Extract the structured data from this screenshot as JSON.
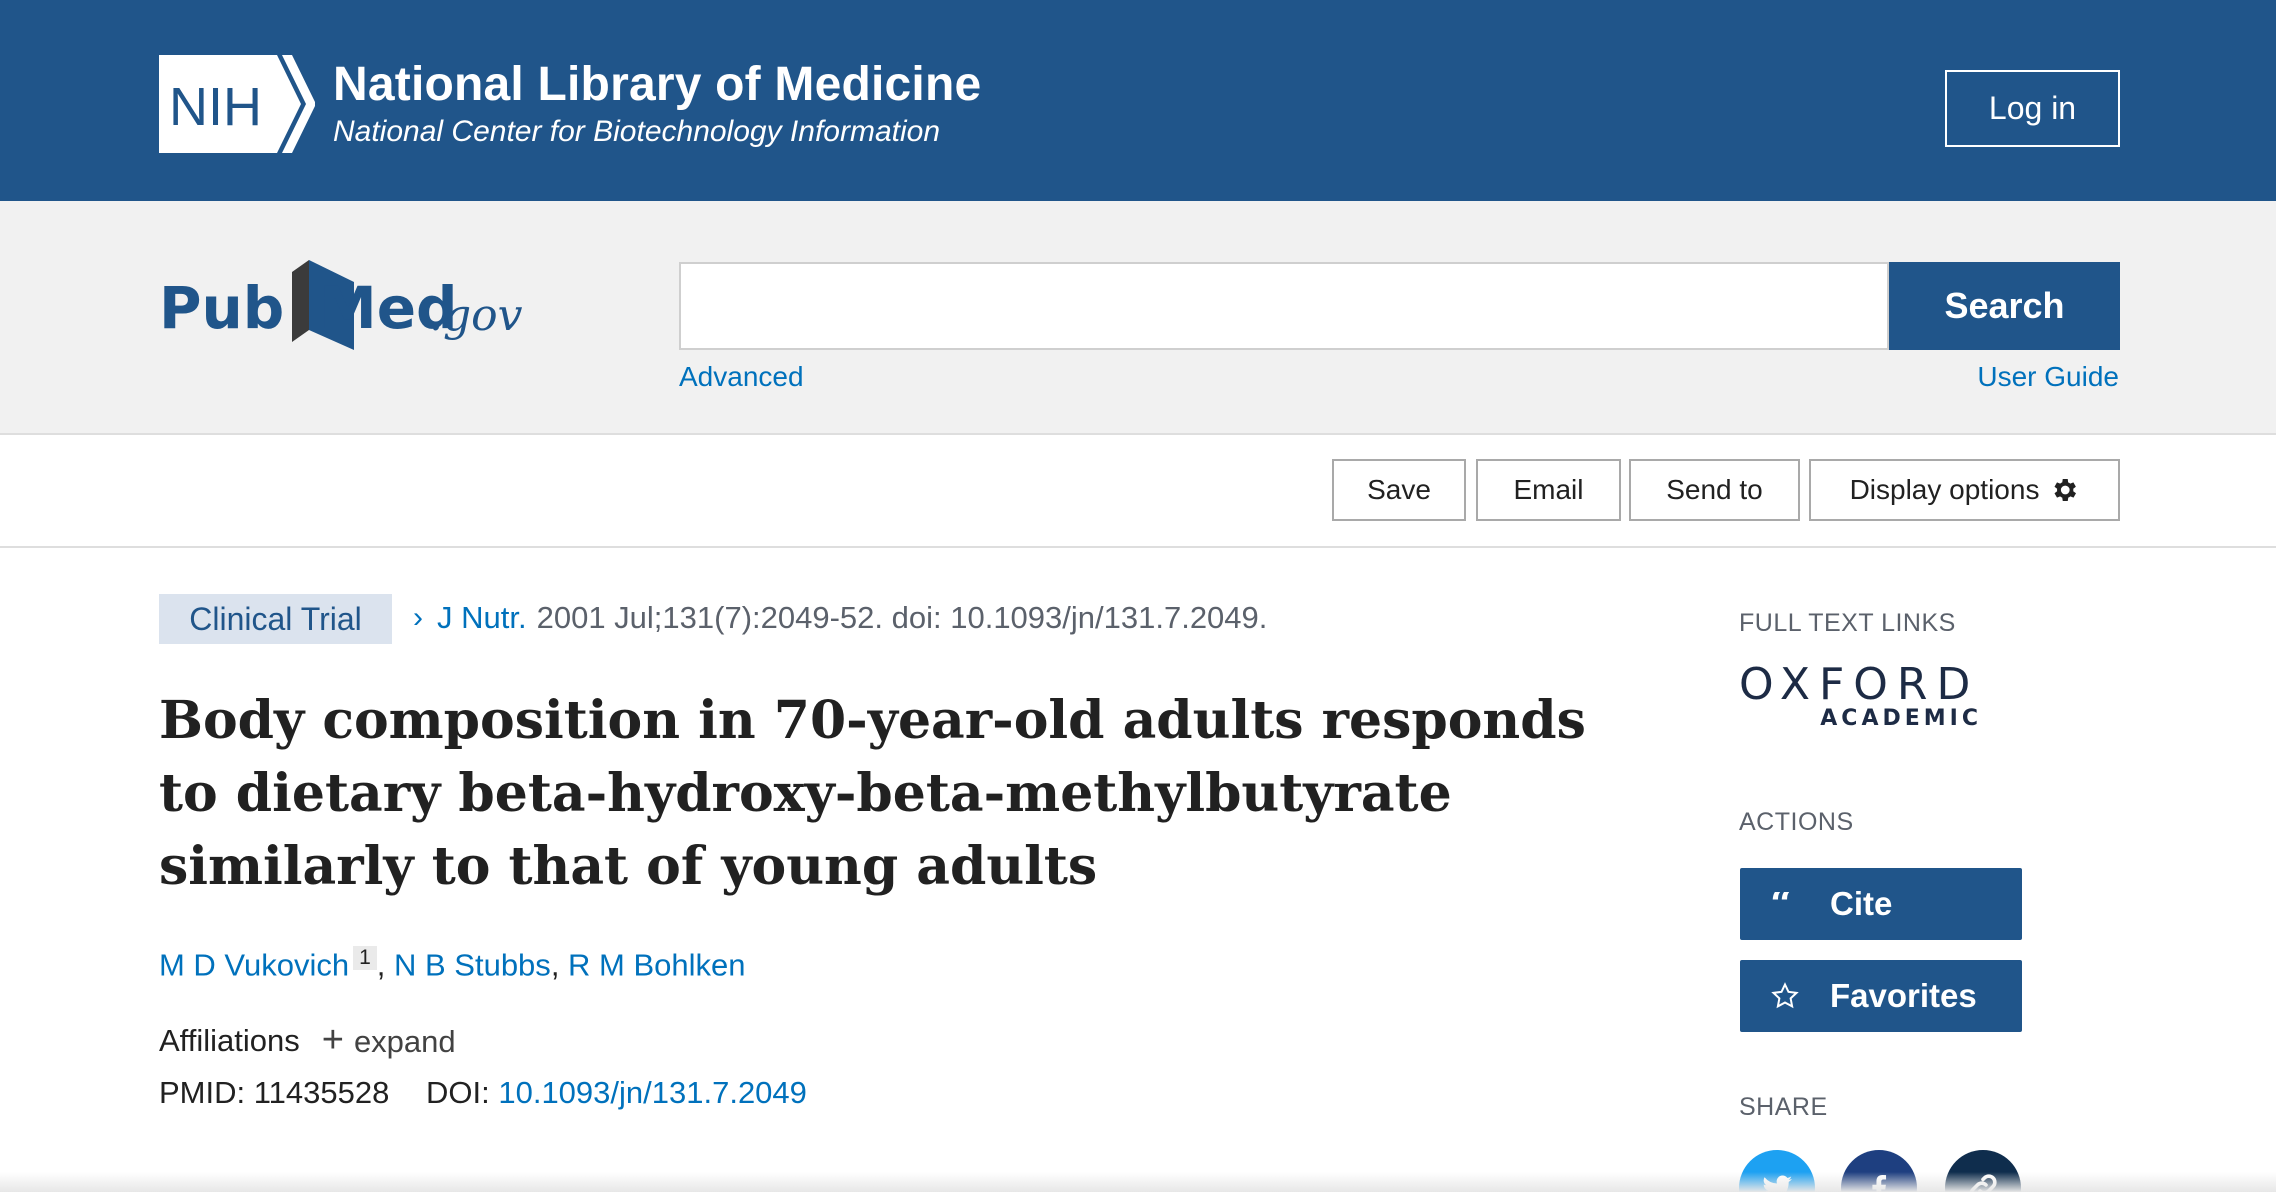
{
  "header": {
    "nih_badge": "NIH",
    "title": "National Library of Medicine",
    "subtitle": "National Center for Biotechnology Information",
    "login_label": "Log in",
    "background_color": "#20558a"
  },
  "search": {
    "logo_text_pub": "Pub",
    "logo_text_med": "Med",
    "logo_text_gov": ".gov",
    "input_value": "",
    "button_label": "Search",
    "advanced_label": "Advanced",
    "user_guide_label": "User Guide"
  },
  "toolbar": {
    "save_label": "Save",
    "email_label": "Email",
    "send_label": "Send to",
    "display_label": "Display options"
  },
  "article": {
    "badge": "Clinical Trial",
    "journal": "J Nutr.",
    "citation_rest": "2001 Jul;131(7):2049-52. doi: 10.1093/jn/131.7.2049.",
    "title": "Body composition in 70-year-old adults responds to dietary beta-hydroxy-beta-methylbutyrate similarly to that of young adults",
    "authors": [
      {
        "name": "M D Vukovich",
        "sup": "1"
      },
      {
        "name": "N B Stubbs"
      },
      {
        "name": "R M Bohlken"
      }
    ],
    "affiliations_label": "Affiliations",
    "expand_label": "expand",
    "pmid_label": "PMID: 11435528",
    "doi_label": "DOI:",
    "doi_value": "10.1093/jn/131.7.2049"
  },
  "sidebar": {
    "full_text_label": "FULL TEXT LINKS",
    "oxford_line1": "OXFORD",
    "oxford_line2": "ACADEMIC",
    "actions_label": "ACTIONS",
    "cite_label": "Cite",
    "favorites_label": "Favorites",
    "share_label": "SHARE",
    "share_icons": [
      "twitter-icon",
      "facebook-icon",
      "permalink-icon"
    ]
  },
  "colors": {
    "accent": "#20558a",
    "link": "#0071bc",
    "band": "#f1f1f1"
  }
}
